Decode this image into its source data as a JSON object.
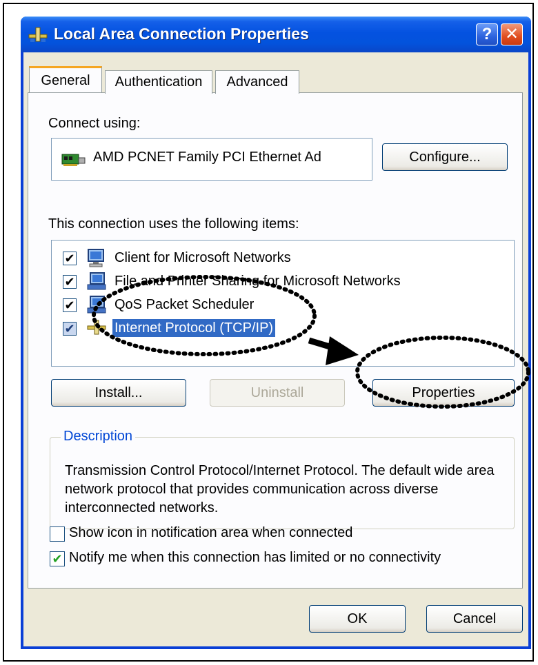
{
  "window": {
    "title": "Local Area Connection Properties",
    "help_label": "?",
    "close_label": "✕"
  },
  "tabs": [
    {
      "label": "General",
      "selected": true
    },
    {
      "label": "Authentication",
      "selected": false
    },
    {
      "label": "Advanced",
      "selected": false
    }
  ],
  "general": {
    "connect_using_label": "Connect using:",
    "adapter_name": "AMD PCNET Family PCI Ethernet Ad",
    "configure_label": "Configure...",
    "items_heading": "This connection uses the following items:",
    "items": [
      {
        "label": "Client for Microsoft Networks",
        "checked": true,
        "icon": "network-client-icon",
        "selected": false
      },
      {
        "label": "File and Printer Sharing for Microsoft Networks",
        "checked": true,
        "icon": "network-service-icon",
        "selected": false
      },
      {
        "label": "QoS Packet Scheduler",
        "checked": true,
        "icon": "network-service-icon",
        "selected": false
      },
      {
        "label": "Internet Protocol (TCP/IP)",
        "checked": true,
        "icon": "protocol-icon",
        "selected": true
      }
    ],
    "install_label": "Install...",
    "uninstall_label": "Uninstall",
    "properties_label": "Properties",
    "description_title": "Description",
    "description_text": "Transmission Control Protocol/Internet Protocol. The default wide area network protocol that provides communication across diverse interconnected networks.",
    "option_show_icon": {
      "label": "Show icon in notification area when connected",
      "checked": false
    },
    "option_notify": {
      "label": "Notify me when this connection has limited or no connectivity",
      "checked": true
    }
  },
  "footer": {
    "ok_label": "OK",
    "cancel_label": "Cancel"
  },
  "colors": {
    "titlebar": "#0452e0",
    "selection": "#316ac5",
    "dialog_background": "#ece9d8",
    "tab_accent": "#f5a623",
    "groupbox_title": "#0046d5",
    "checkmark_green": "#21a121"
  }
}
